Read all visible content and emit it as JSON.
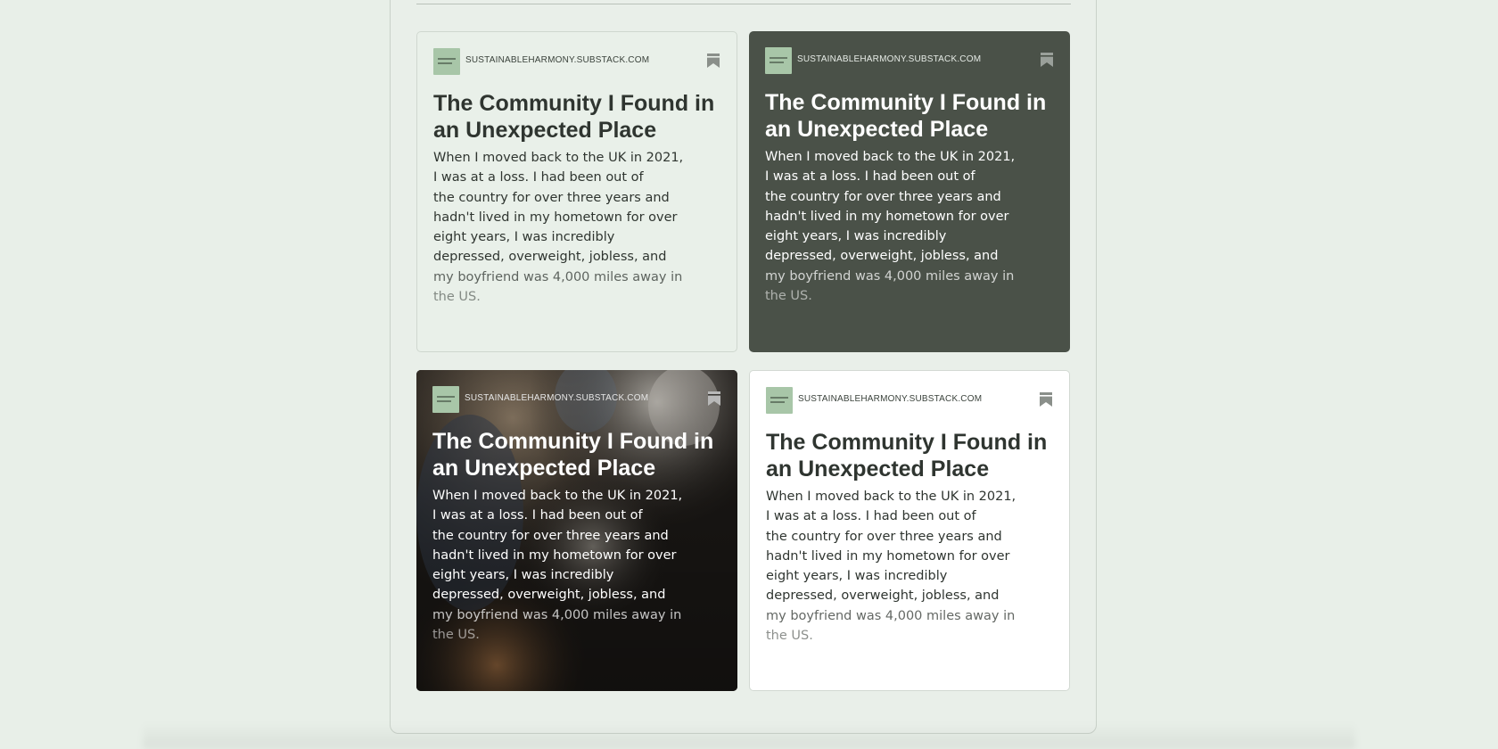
{
  "cards": [
    {
      "domain": "SUSTAINABLEHARMONY.SUBSTACK.COM",
      "title": "The Community I Found in an Unexpected Place",
      "body_lines": [
        "When I moved back to the UK in 2021,",
        "I was at a loss. I had been out of",
        "the country for over three years and",
        "hadn't lived in my hometown for over",
        "eight years, I was incredibly",
        "depressed, overweight, jobless, and",
        "my boyfriend was 4,000 miles away in",
        "the US."
      ],
      "theme": "light-green",
      "background": "#e9f0e9"
    },
    {
      "domain": "SUSTAINABLEHARMONY.SUBSTACK.COM",
      "title": "The Community I Found in an Unexpected Place",
      "body_lines": [
        "When I moved back to the UK in 2021,",
        "I was at a loss. I had been out of",
        "the country for over three years and",
        "hadn't lived in my hometown for over",
        "eight years, I was incredibly",
        "depressed, overweight, jobless, and",
        "my boyfriend was 4,000 miles away in",
        "the US."
      ],
      "theme": "dark-green",
      "background": "#4a5148"
    },
    {
      "domain": "SUSTAINABLEHARMONY.SUBSTACK.COM",
      "title": "The Community I Found in an Unexpected Place",
      "body_lines": [
        "When I moved back to the UK in 2021,",
        "I was at a loss. I had been out of",
        "the country for over three years and",
        "hadn't lived in my hometown for over",
        "eight years, I was incredibly",
        "depressed, overweight, jobless, and",
        "my boyfriend was 4,000 miles away in",
        "the US."
      ],
      "theme": "photo",
      "background": "#22201d"
    },
    {
      "domain": "SUSTAINABLEHARMONY.SUBSTACK.COM",
      "title": "The Community I Found in an Unexpected Place",
      "body_lines": [
        "When I moved back to the UK in 2021,",
        "I was at a loss. I had been out of",
        "the country for over three years and",
        "hadn't lived in my hometown for over",
        "eight years, I was incredibly",
        "depressed, overweight, jobless, and",
        "my boyfriend was 4,000 miles away in",
        "the US."
      ],
      "theme": "white",
      "background": "#ffffff"
    }
  ],
  "icons": {
    "logo": "publication-logo-icon",
    "bookmark": "bookmark-icon"
  },
  "colors": {
    "page_background": "#e8efe8",
    "logo_green": "#a8c6a8",
    "bookmark_gray": "#8a8f8a"
  }
}
